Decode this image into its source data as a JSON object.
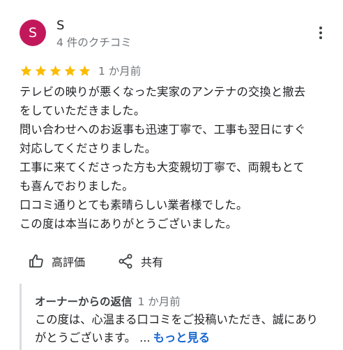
{
  "user": {
    "initial": "S",
    "name": "S",
    "review_count": "4 件のクチコミ",
    "avatar_color": "#c2185b"
  },
  "menu": {
    "icon": "more-vert-icon"
  },
  "rating": {
    "stars": 5,
    "max_stars": 5,
    "star_color": "#fbbc04",
    "time": "1 か月前"
  },
  "review": {
    "lines": [
      "テレビの映りが悪くなった実家のアンテナの交換と撤去",
      "をしていただきました。",
      "問い合わせへのお返事も迅速丁寧で、工事も翌日にすぐ",
      "対応してくださりました。",
      "工事に来てくださった方も大変親切丁寧で、両親もとて",
      "も喜んでおりました。",
      "口コミ通りとても素晴らしい業者様でした。",
      "この度は本当にありがとうございました。"
    ]
  },
  "actions": {
    "like_label": "高評価",
    "share_label": "共有"
  },
  "owner_reply": {
    "title": "オーナーからの返信",
    "time": "1 か月前",
    "line1": "この度は、心温まる口コミをご投稿いただき、誠にあり",
    "line2": "がとうございます。 ...",
    "more_label": "もっと見る"
  }
}
